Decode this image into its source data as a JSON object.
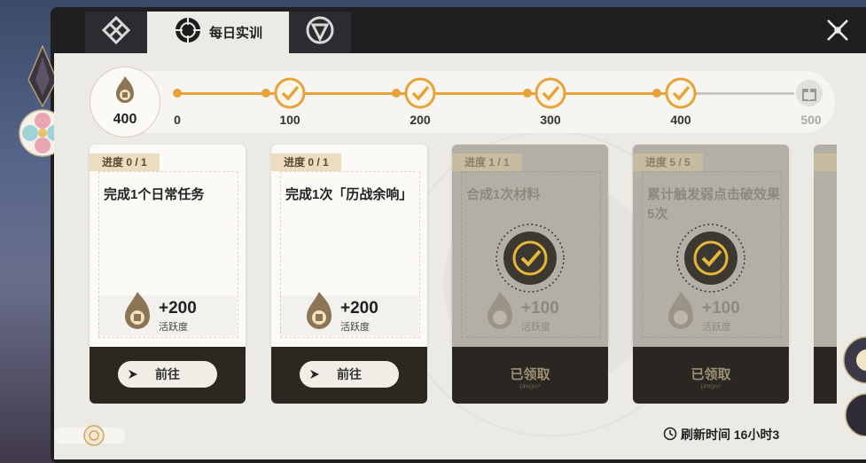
{
  "tabs": [
    {
      "label": "",
      "icon": "diamond-knot-icon"
    },
    {
      "label": "每日实训",
      "icon": "crosshair-emblem-icon"
    },
    {
      "label": "",
      "icon": "shield-triangle-icon"
    }
  ],
  "points": {
    "value": "400"
  },
  "milestones": [
    {
      "label": "0",
      "reached": true
    },
    {
      "label": "100",
      "reached": true
    },
    {
      "label": "200",
      "reached": true
    },
    {
      "label": "300",
      "reached": true
    },
    {
      "label": "400",
      "reached": true
    },
    {
      "label": "500",
      "reached": false
    }
  ],
  "cards": [
    {
      "progress": "进度 0 / 1",
      "title": "完成1个日常任务",
      "reward": "+200",
      "reward_label": "活跃度",
      "button": "前往",
      "state": "go"
    },
    {
      "progress": "进度 0 / 1",
      "title": "完成1次「历战余响」",
      "reward": "+200",
      "reward_label": "活跃度",
      "button": "前往",
      "state": "go"
    },
    {
      "progress": "进度 1 / 1",
      "title": "合成1次材料",
      "reward": "+100",
      "reward_label": "活跃度",
      "button": "已领取",
      "sub": "(4%)m³",
      "state": "claimed"
    },
    {
      "progress": "进度 5 / 5",
      "title": "累计触发弱点击破效果5次",
      "reward": "+100",
      "reward_label": "活跃度",
      "button": "已领取",
      "sub": "(4%)m³",
      "state": "claimed"
    }
  ],
  "refresh": {
    "text": "刷新时间 16小时3"
  },
  "colors": {
    "accent": "#e8a23a",
    "dark": "#2b2822",
    "panel": "#eceae5"
  }
}
